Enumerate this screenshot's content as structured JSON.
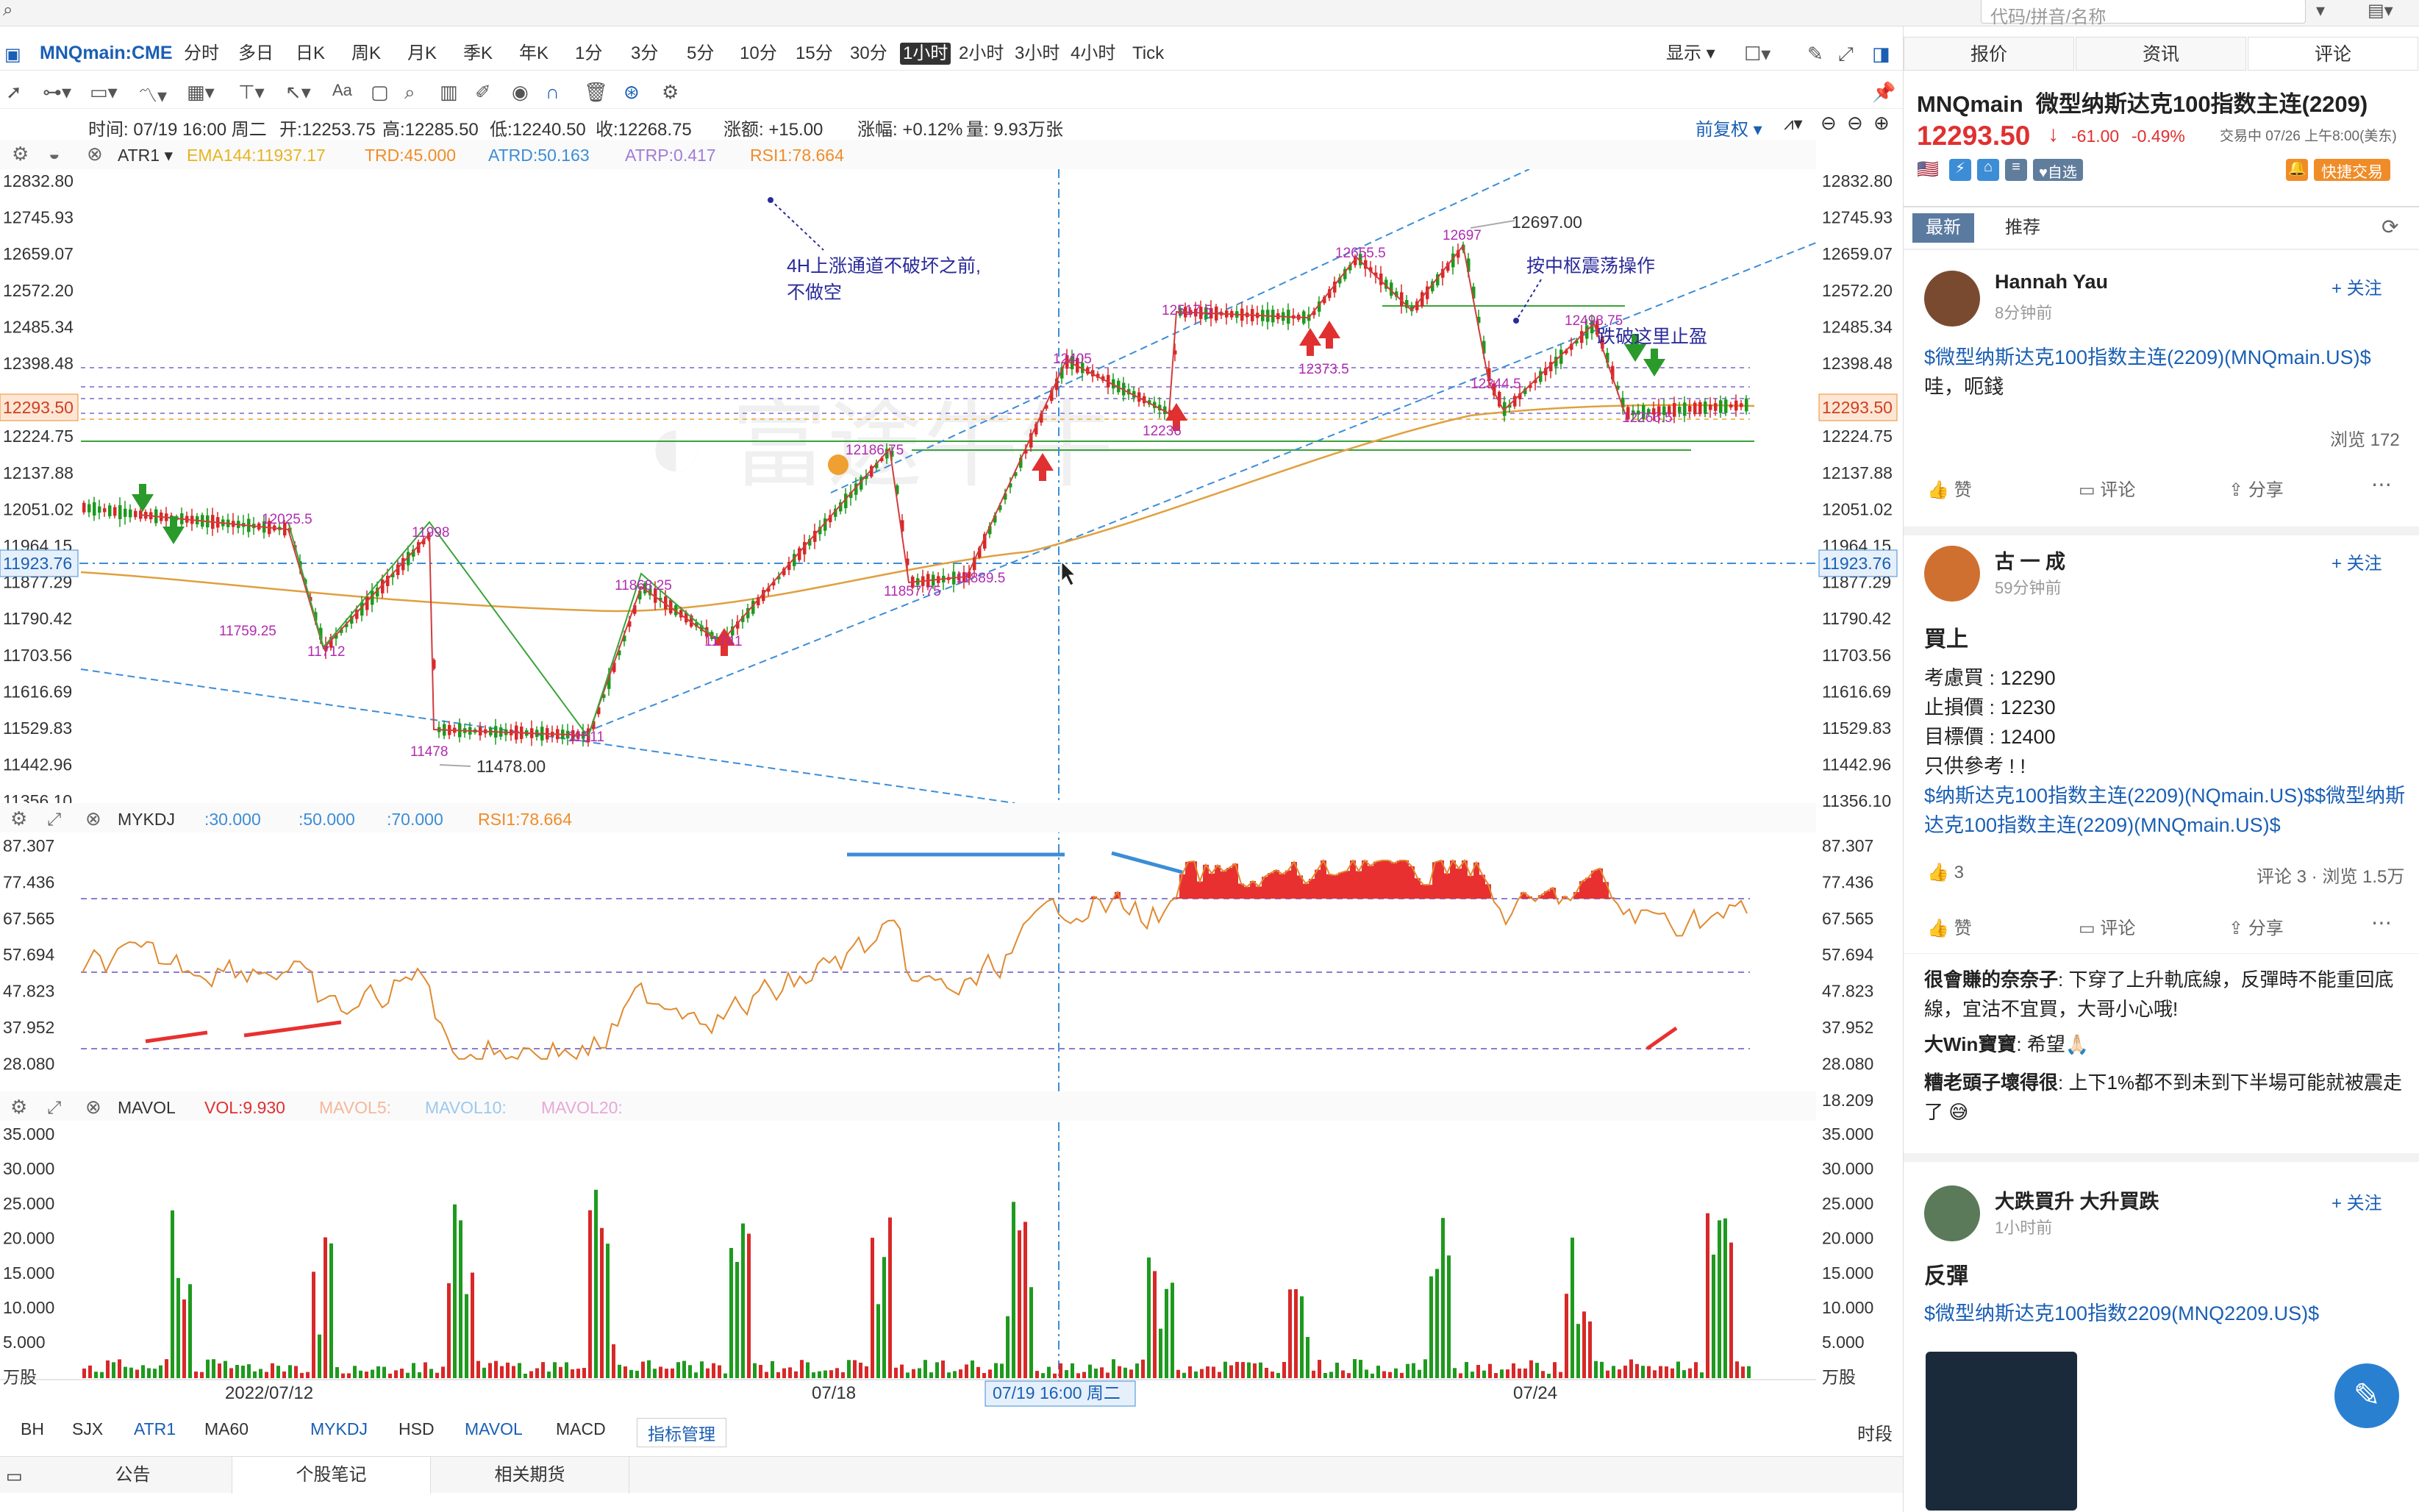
{
  "search": {
    "placeholder": "代码/拼音/名称"
  },
  "symbol": "MNQmain:CME",
  "periods": [
    "分时",
    "多日",
    "日K",
    "周K",
    "月K",
    "季K",
    "年K",
    "1分",
    "3分",
    "5分",
    "10分",
    "15分",
    "30分",
    "1小时",
    "2小时",
    "3小时",
    "4小时",
    "Tick"
  ],
  "active_period": "1小时",
  "toolbar_right": {
    "display": "显示"
  },
  "infobar": {
    "time": "时间: 07/19 16:00 周二",
    "open": "开:12253.75",
    "high": "高:12285.50",
    "low": "低:12240.50",
    "close": "收:12268.75",
    "change": "涨额: +15.00",
    "pct": "涨幅: +0.12%",
    "vol": "量: 9.93万张",
    "adjust": "前复权"
  },
  "main_indicators": {
    "atr": "ATR1",
    "ema": "EMA144:11937.17",
    "trd": "TRD:45.000",
    "atrd": "ATRD:50.163",
    "atrp": "ATRP:0.417",
    "rsi": "RSI1:78.664"
  },
  "main_axis": [
    "12832.80",
    "12745.93",
    "12659.07",
    "12572.20",
    "12485.34",
    "12398.48",
    "12311.61",
    "12224.75",
    "12137.88",
    "12051.02",
    "11964.15",
    "11877.29",
    "11790.42",
    "11703.56",
    "11616.69",
    "11529.83",
    "11442.96",
    "11356.10"
  ],
  "price_label": "12293.50",
  "cursor_price": "11923.76",
  "annotations": {
    "note1_l1": "4H上涨通道不破坏之前,",
    "note1_l2": "不做空",
    "note2": "按中枢震荡操作",
    "note3": "跌破这里止盈",
    "p12697": "12697.00",
    "p11478": "11478.00"
  },
  "peak_labels": [
    "12025.5",
    "11998",
    "11759.25",
    "11712",
    "11478",
    "11511",
    "11868.25",
    "11741",
    "12186.75",
    "11857.75",
    "11889.5",
    "12405",
    "12517.5",
    "12236",
    "12655.5",
    "12373.5",
    "12697",
    "12344.5",
    "12498.75",
    "12266.5"
  ],
  "kdj": {
    "name": "MYKDJ",
    "p1": ":30.000",
    "p2": ":50.000",
    "p3": ":70.000",
    "rsi": "RSI1:78.664",
    "axis": [
      "87.307",
      "77.436",
      "67.565",
      "57.694",
      "47.823",
      "37.952",
      "28.080",
      "18.209"
    ]
  },
  "mavol": {
    "name": "MAVOL",
    "vol": "VOL:9.930",
    "m5": "MAVOL5:",
    "m10": "MAVOL10:",
    "m20": "MAVOL20:",
    "axis": [
      "35.000",
      "30.000",
      "25.000",
      "20.000",
      "15.000",
      "10.000",
      "5.000",
      "万股"
    ]
  },
  "xaxis": {
    "d1": "2022/07/12",
    "d2": "07/18",
    "cursor": "07/19 16:00 周二",
    "d3": "07/24"
  },
  "ind_tabs": [
    "BH",
    "SJX",
    "ATR1",
    "MA60",
    "MYKDJ",
    "HSD",
    "MAVOL",
    "MACD",
    "指标管理"
  ],
  "period_label": "时段",
  "bottom_tabs": [
    "公告",
    "个股笔记",
    "相关期货"
  ],
  "right": {
    "tabs": [
      "报价",
      "资讯",
      "评论"
    ],
    "title": "MNQmain  微型纳斯达克100指数主连(2209)",
    "price": "12293.50",
    "change": "-61.00",
    "pct": "-0.49%",
    "status": "交易中 07/26 上午8:00(美东)",
    "tag_self": "自选",
    "quick": "快捷交易",
    "feed_tabs": [
      "最新",
      "推荐"
    ],
    "posts": [
      {
        "name": "Hannah Yau",
        "time": "8分钟前",
        "follow": "+ 关注",
        "link": "$微型纳斯达克100指数主连(2209)(MNQmain.US)$",
        "text": "哇，呃錢",
        "views": "浏览 172",
        "like": "赞",
        "comment": "评论",
        "share": "分享"
      },
      {
        "name": "古 一 成",
        "time": "59分钟前",
        "follow": "+ 关注",
        "heading": "買上",
        "lines": [
          "考慮買 : 12290",
          "止損價 : 12230",
          "目標價 : 12400",
          "只供參考 ! !"
        ],
        "link": "$纳斯达克100指数主连(2209)(NQmain.US)$$微型纳斯达克100指数主连(2209)(MNQmain.US)$",
        "likes": "3",
        "stats": "评论 3 · 浏览 1.5万",
        "like": "赞",
        "comment": "评论",
        "share": "分享",
        "replies": [
          {
            "user": "很會賺的奈奈子",
            "text": ": 下穿了上升軌底線，反彈時不能重回底線，宜沽不宜買，大哥小心哦!"
          },
          {
            "user": "大Win寶寶",
            "text": ": 希望🙏🏻"
          },
          {
            "user": "糟老頭子壞得很",
            "text": ": 上下1%都不到未到下半場可能就被震走了 😅"
          }
        ]
      },
      {
        "name": "大跌買升 大升買跌",
        "time": "1小时前",
        "follow": "+ 关注",
        "heading": "反彈",
        "link": "$微型纳斯达克100指数2209(MNQ2209.US)$"
      }
    ]
  }
}
